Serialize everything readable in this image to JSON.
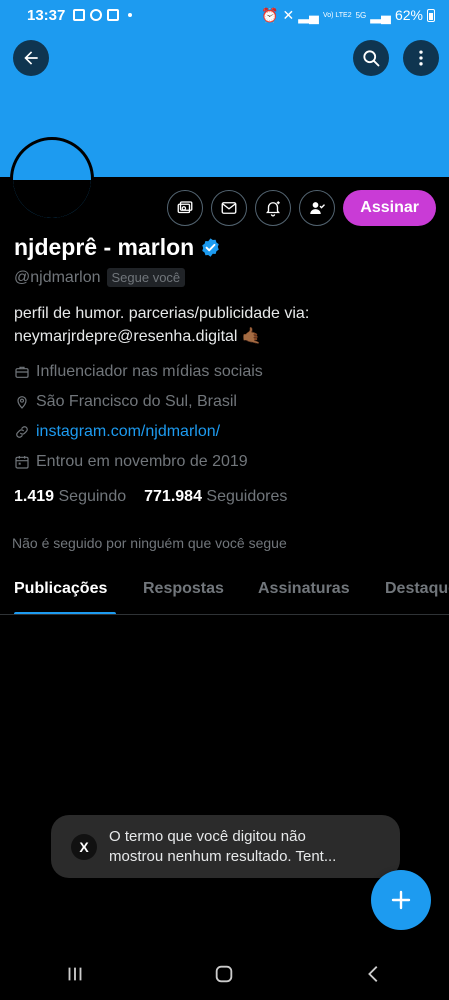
{
  "status_bar": {
    "time": "13:37",
    "battery": "62%",
    "network_5g": "5G",
    "network_volte": "Vo) LTE2"
  },
  "header": {
    "back_icon": "arrow-left-icon",
    "search_icon": "search-icon",
    "more_icon": "more-vertical-icon"
  },
  "actions": {
    "subscribe_label": "Assinar",
    "icons": [
      "monetize-icon",
      "message-icon",
      "notification-bell-icon",
      "follow-user-icon"
    ]
  },
  "profile": {
    "display_name": "njdeprê - marlon",
    "handle": "@njdmarlon",
    "follows_you": "Segue você",
    "bio_line1": "perfil de humor. parcerias/publicidade via:",
    "bio_line2": "neymarjrdepre@resenha.digital 🤙🏾",
    "category": "Influenciador nas mídias sociais",
    "location": "São Francisco do Sul, Brasil",
    "website": "instagram.com/njdmarlon/",
    "joined": "Entrou em novembro de 2019",
    "following_count": "1.419",
    "following_label": "Seguindo",
    "followers_count": "771.984",
    "followers_label": "Seguidores",
    "not_followed_text": "Não é seguido por ninguém que você segue"
  },
  "tabs": [
    {
      "label": "Publicações",
      "active": true
    },
    {
      "label": "Respostas",
      "active": false
    },
    {
      "label": "Assinaturas",
      "active": false
    },
    {
      "label": "Destaques",
      "active": false
    }
  ],
  "toast": {
    "logo": "X",
    "line1": "O termo que você digitou não",
    "line2": "mostrou nenhum resultado. Tent..."
  },
  "fab": {
    "icon": "plus-icon"
  },
  "colors": {
    "accent": "#1d9bf0",
    "subscribe": "#c93bd6",
    "background": "#000000",
    "muted": "#71767b"
  }
}
